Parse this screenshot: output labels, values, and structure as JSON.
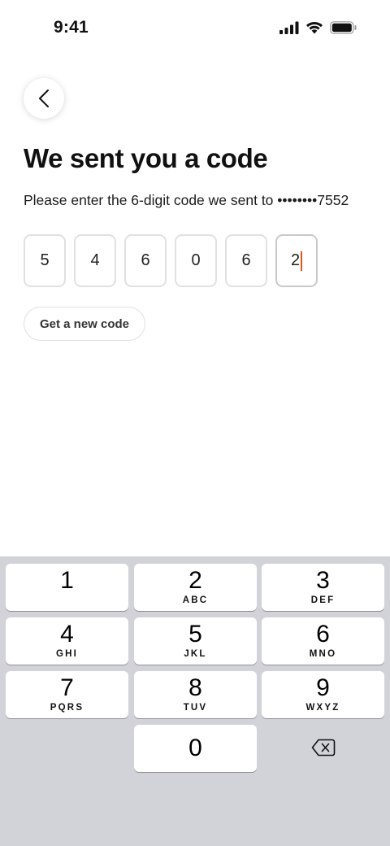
{
  "status_bar": {
    "time": "9:41",
    "icons": [
      "cellular-signal-icon",
      "wifi-icon",
      "battery-icon"
    ]
  },
  "back_button": {
    "icon": "chevron-left-icon"
  },
  "title": "We sent you a code",
  "subtitle": "Please enter the 6-digit code we sent to ••••••••7552",
  "code": {
    "digits": [
      "5",
      "4",
      "6",
      "0",
      "6",
      "2"
    ],
    "active_index": 5,
    "caret_color": "#e0561a"
  },
  "new_code_button": {
    "label": "Get a new code"
  },
  "keypad": {
    "keys": [
      {
        "num": "1",
        "letters": ""
      },
      {
        "num": "2",
        "letters": "ABC"
      },
      {
        "num": "3",
        "letters": "DEF"
      },
      {
        "num": "4",
        "letters": "GHI"
      },
      {
        "num": "5",
        "letters": "JKL"
      },
      {
        "num": "6",
        "letters": "MNO"
      },
      {
        "num": "7",
        "letters": "PQRS"
      },
      {
        "num": "8",
        "letters": "TUV"
      },
      {
        "num": "9",
        "letters": "WXYZ"
      },
      {
        "num": "0",
        "letters": ""
      }
    ],
    "delete_icon": "backspace-icon",
    "background": "#d1d3d9"
  }
}
